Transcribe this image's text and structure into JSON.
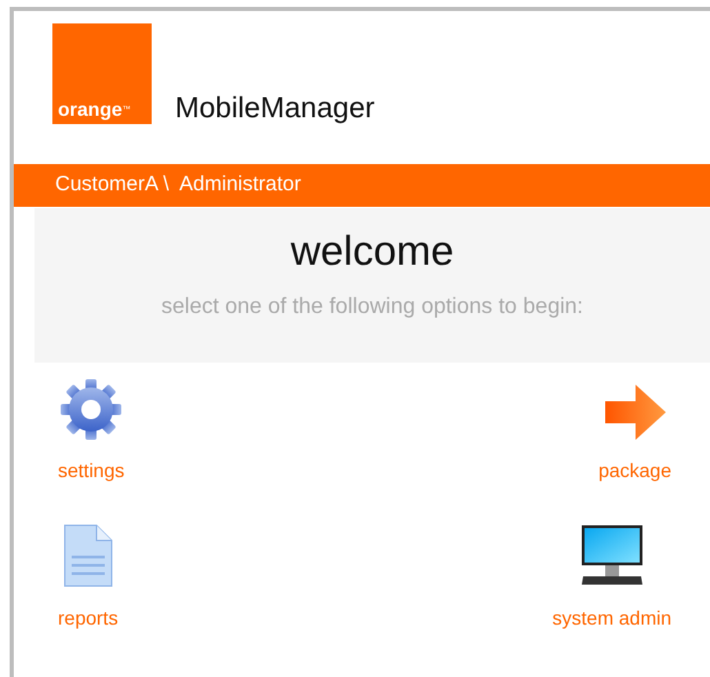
{
  "logo": {
    "text": "orange",
    "trademark": "™"
  },
  "app_title": "MobileManager",
  "breadcrumb": "CustomerA \\  Administrator",
  "welcome": {
    "title": "welcome",
    "subtitle": "select one of the following options to begin:"
  },
  "options": [
    {
      "kind": "gear",
      "label": "settings"
    },
    {
      "kind": "arrow",
      "label": "package"
    },
    {
      "kind": "document",
      "label": "reports"
    },
    {
      "kind": "monitor",
      "label": "system admin"
    }
  ]
}
